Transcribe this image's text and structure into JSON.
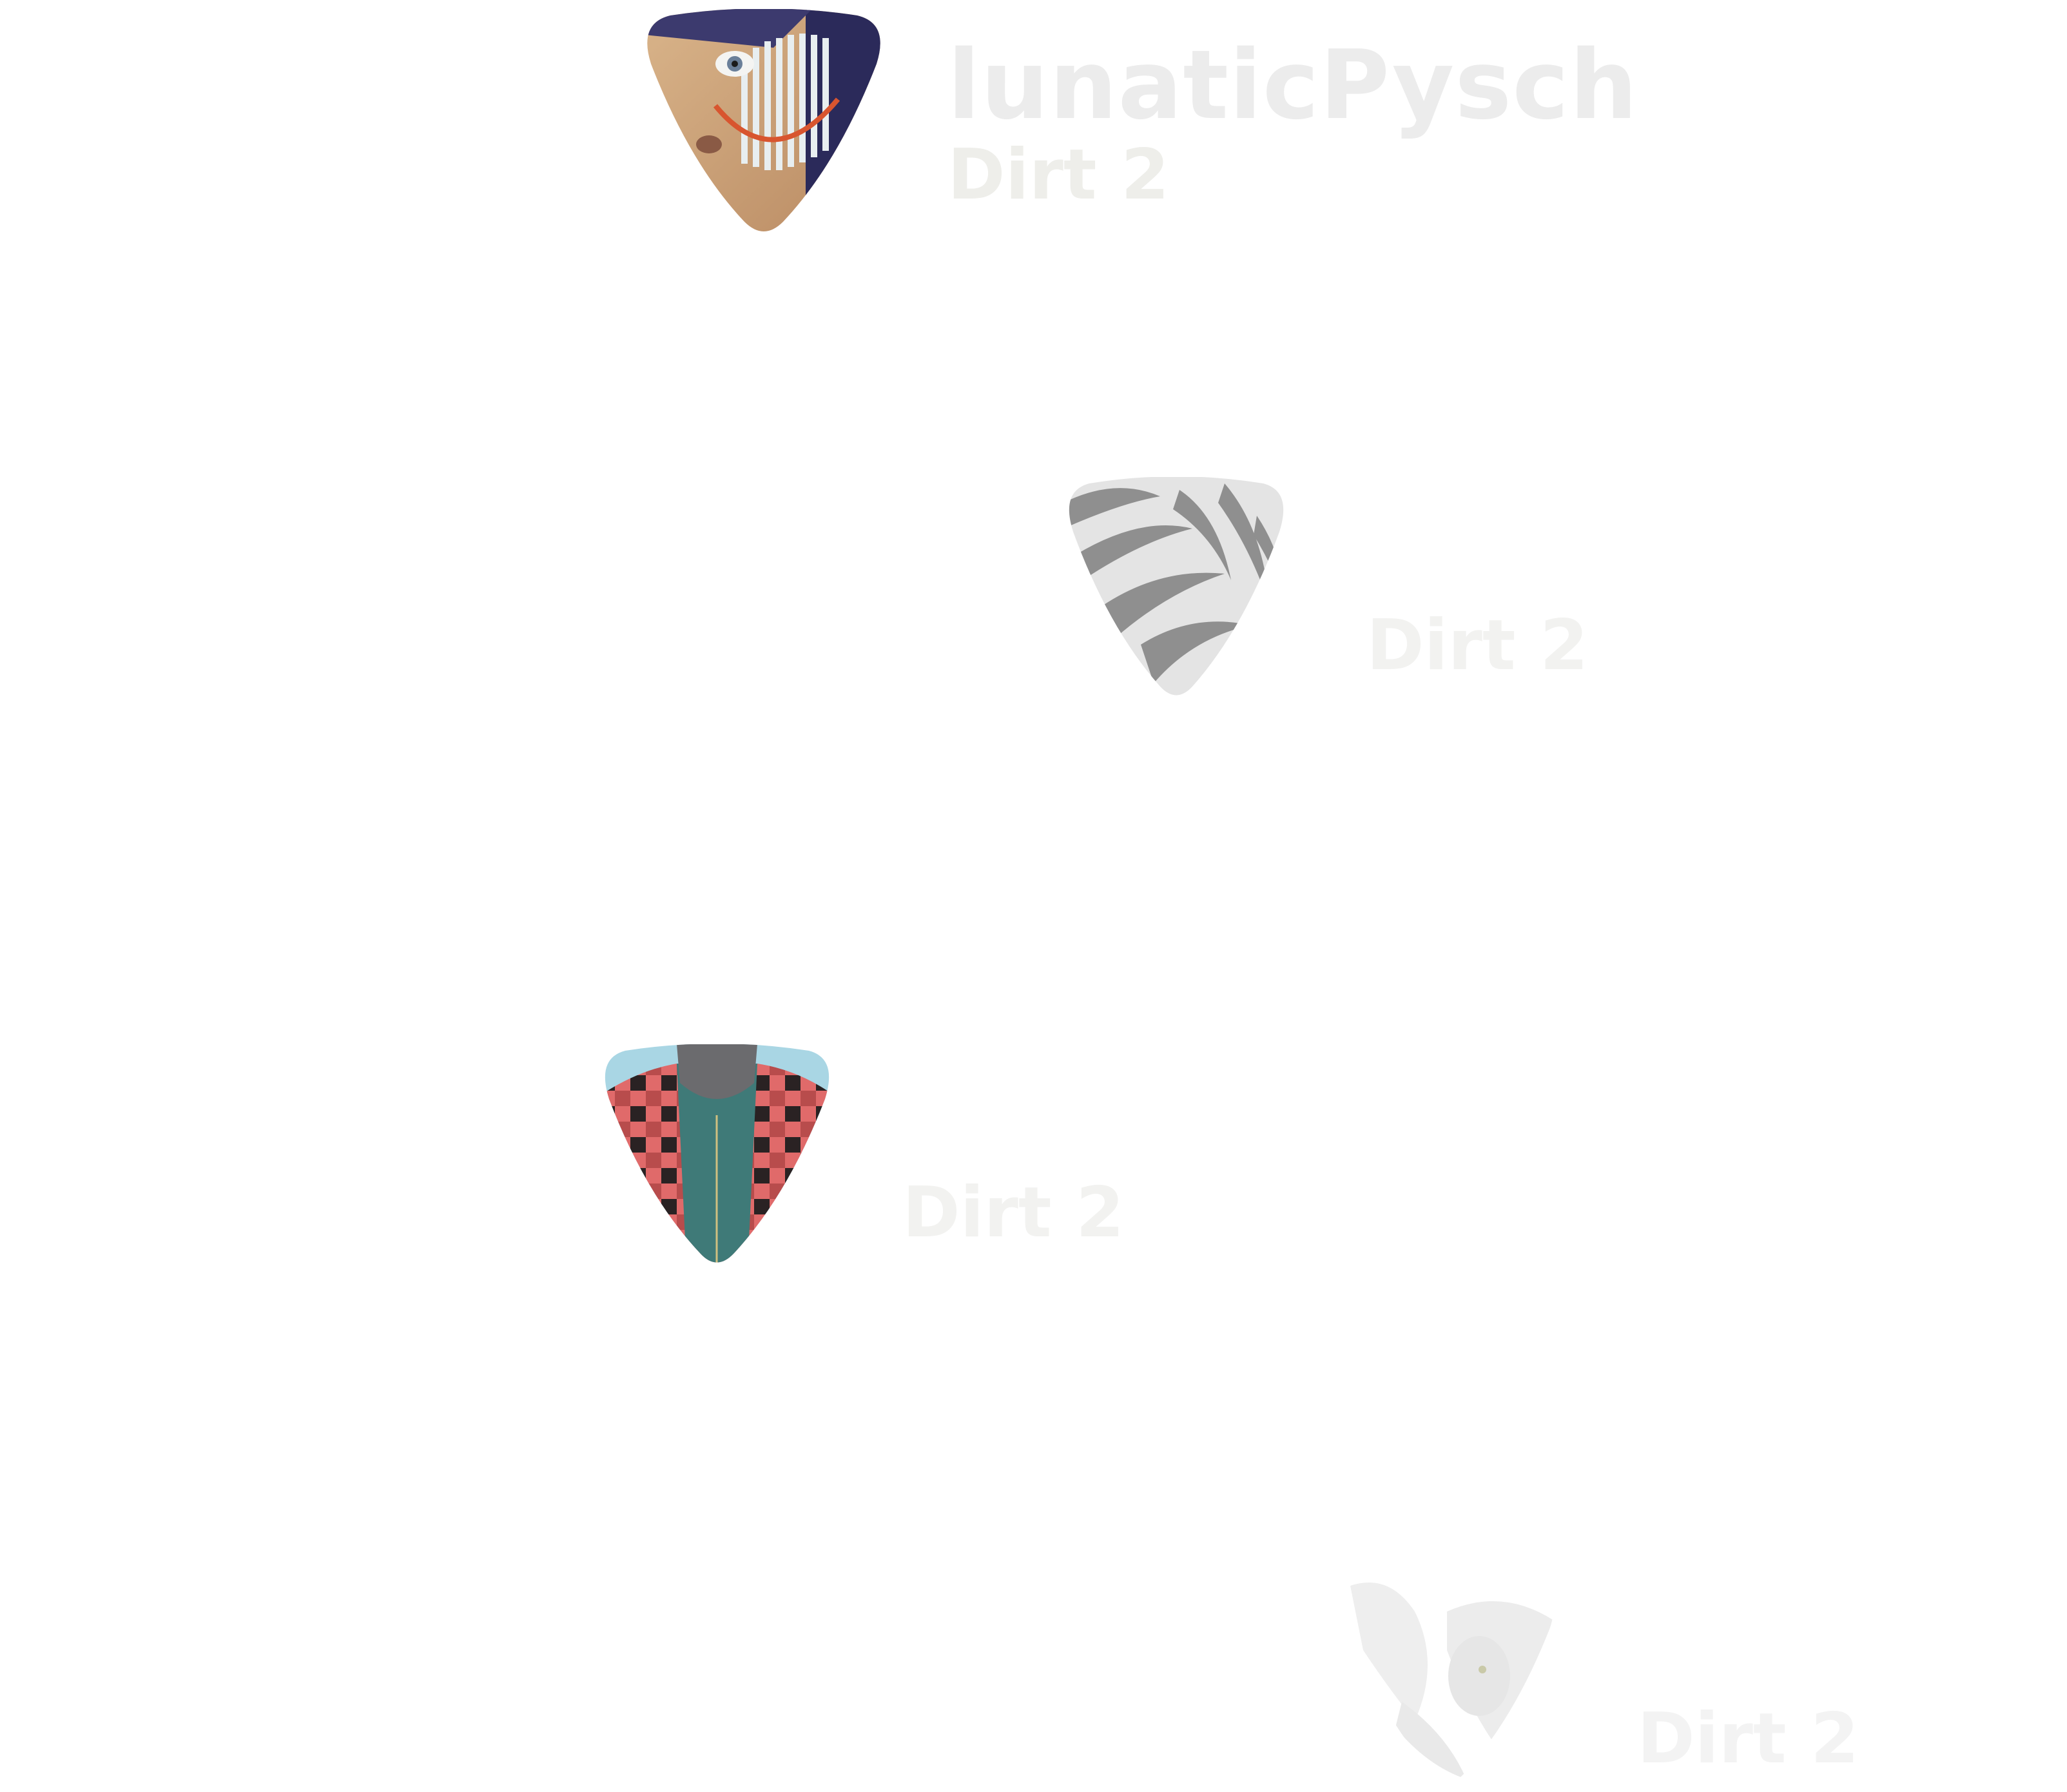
{
  "tracks": [
    {
      "artist": "lunaticPysch",
      "album": "Dirt 2",
      "artwork_icon": "painted-face-artwork-icon"
    },
    {
      "artist": "",
      "album": "Dirt 2",
      "artwork_icon": "zebra-pattern-artwork-icon"
    },
    {
      "artist": "",
      "album": "Dirt 2",
      "artwork_icon": "plaid-shirt-artwork-icon"
    },
    {
      "artist": "",
      "album": "Dirt 2",
      "artwork_icon": "white-owl-artwork-icon"
    }
  ],
  "colors": {
    "background": "#ffffff",
    "label_text": "#ececec"
  }
}
